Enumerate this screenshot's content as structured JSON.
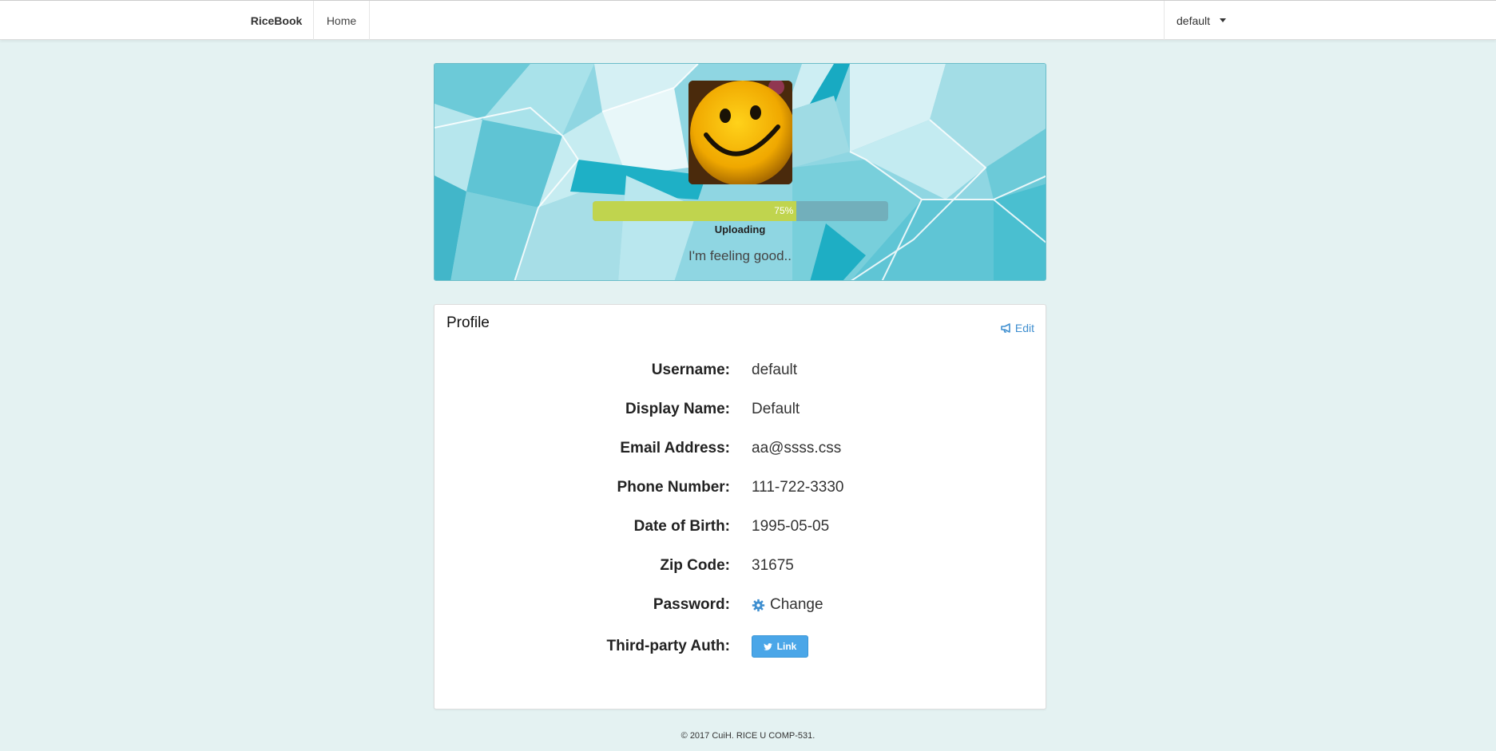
{
  "navbar": {
    "brand": "RiceBook",
    "home": "Home",
    "user": "default"
  },
  "banner": {
    "progress_percent": 75,
    "progress_label": "75%",
    "upload_status": "Uploading",
    "headline": "I'm feeling good.."
  },
  "profile": {
    "title": "Profile",
    "edit_label": "Edit",
    "fields": [
      {
        "label": "Username:",
        "value": "default"
      },
      {
        "label": "Display Name:",
        "value": "Default"
      },
      {
        "label": "Email Address:",
        "value": "aa@ssss.css"
      },
      {
        "label": "Phone Number:",
        "value": "111-722-3330"
      },
      {
        "label": "Date of Birth:",
        "value": "1995-05-05"
      },
      {
        "label": "Zip Code:",
        "value": "31675"
      }
    ],
    "password_label": "Password:",
    "password_action": "Change",
    "auth_label": "Third-party Auth:",
    "auth_button": "Link"
  },
  "footer": "© 2017 CuiH. RICE U COMP-531.",
  "colors": {
    "accent": "#3f8fd0",
    "progress": "#c0d44e",
    "twitter": "#4aa6e8",
    "background": "#e4f2f2"
  }
}
